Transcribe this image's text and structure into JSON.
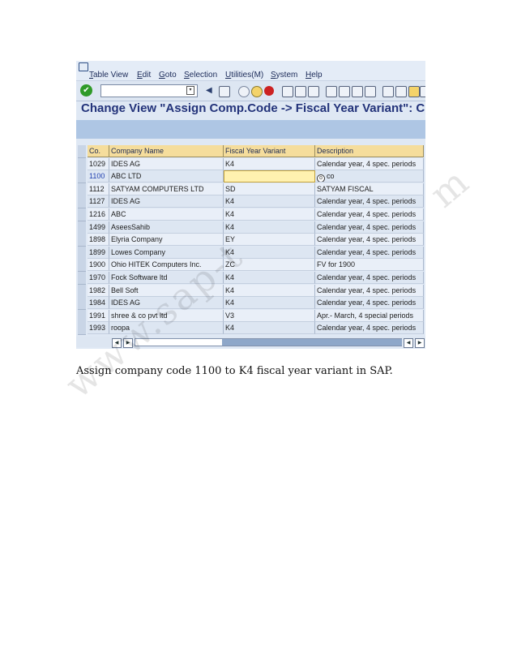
{
  "menu": {
    "items": [
      "Table View",
      "Edit",
      "Goto",
      "Selection",
      "Utilities(M)",
      "System",
      "Help"
    ]
  },
  "toolbar": {
    "icons": [
      "ok-icon",
      "command-field",
      "back-icon",
      "save-icon",
      "exit-icon",
      "cancel-icon",
      "print-icon",
      "find-icon",
      "find-next-icon",
      "first-page-icon",
      "prev-page-icon",
      "next-page-icon",
      "last-page-icon",
      "new-session-icon",
      "shortcut-icon"
    ]
  },
  "screen": {
    "title": "Change View \"Assign Comp.Code -> Fiscal Year Variant\": C"
  },
  "table": {
    "columns": [
      "Co.",
      "Company Name",
      "Fiscal Year Variant",
      "Description"
    ],
    "rows": [
      [
        "1029",
        "IDES AG",
        "K4",
        "Calendar year, 4 spec. periods"
      ],
      [
        "1100",
        "ABC LTD",
        "",
        "co"
      ],
      [
        "1112",
        "SATYAM COMPUTERS LTD",
        "SD",
        "SATYAM FISCAL"
      ],
      [
        "1127",
        "IDES AG",
        "K4",
        "Calendar year, 4 spec. periods"
      ],
      [
        "1216",
        "ABC",
        "K4",
        "Calendar year, 4 spec. periods"
      ],
      [
        "1499",
        "AseesSahib",
        "K4",
        "Calendar year, 4 spec. periods"
      ],
      [
        "1898",
        "Elyria Company",
        "EY",
        "Calendar year, 4 spec. periods"
      ],
      [
        "1899",
        "Lowes Company",
        "K4",
        "Calendar year, 4 spec. periods"
      ],
      [
        "1900",
        "Ohio HITEK Computers Inc.",
        "ZC",
        "FV for 1900"
      ],
      [
        "1970",
        "Fock Software ltd",
        "K4",
        "Calendar year, 4 spec. periods"
      ],
      [
        "1982",
        "Bell Soft",
        "K4",
        "Calendar year, 4 spec. periods"
      ],
      [
        "1984",
        "IDES AG",
        "K4",
        "Calendar year, 4 spec. periods"
      ],
      [
        "1991",
        "shree & co pvt ltd",
        "V3",
        "Apr.- March, 4 special periods"
      ],
      [
        "1993",
        "roopa",
        "K4",
        "Calendar year, 4 spec. periods"
      ]
    ],
    "selected_row": 1
  },
  "caption": "Assign company code 1100 to K4 fiscal year variant in SAP.",
  "watermark": "www.sap-t",
  "watermark_tail": "m",
  "colors": {
    "title": "#23337a",
    "header": "#f5dd9c",
    "band": "#aec6e4",
    "input_highlight": "#fff1b0"
  }
}
